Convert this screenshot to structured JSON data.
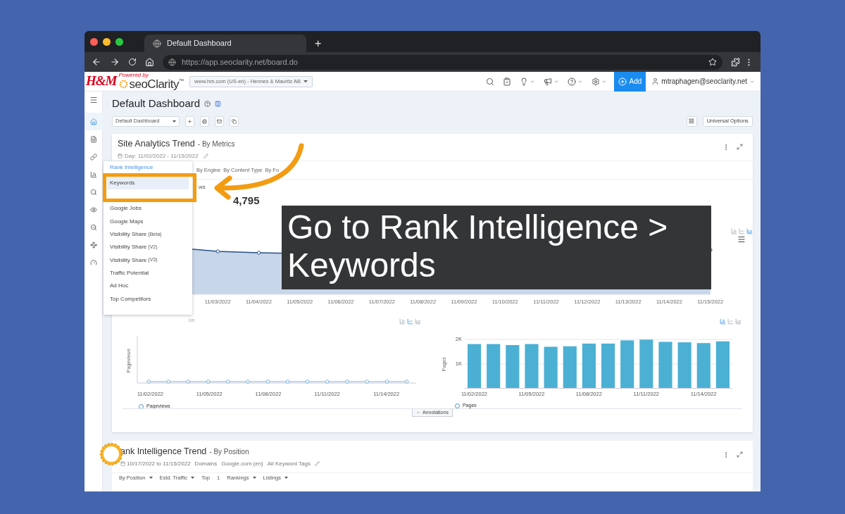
{
  "browser": {
    "tab_title": "Default Dashboard",
    "new_tab": "+",
    "url": "https://app.seoclarity.net/board.do"
  },
  "header": {
    "client_logo": "H&M",
    "powered_by": "Powered by",
    "brand": "seoClarity",
    "trademark": "™",
    "domain_select": "www.hm.com (US-en) - Hennes & Mauritz AB",
    "add_button": "Add",
    "user": "mtraphagen@seoclarity.net",
    "tools": [
      {
        "kind": "search",
        "caret": false
      },
      {
        "kind": "clipboard",
        "caret": false
      },
      {
        "kind": "bulb",
        "caret": true
      },
      {
        "kind": "megaphone",
        "caret": true
      },
      {
        "kind": "help",
        "caret": true
      },
      {
        "kind": "settings",
        "caret": true
      }
    ]
  },
  "sidebar": {
    "items": [
      {
        "kind": "home",
        "selected": true
      },
      {
        "kind": "document",
        "selected": false
      },
      {
        "kind": "link",
        "selected": false
      },
      {
        "kind": "chart",
        "selected": false
      },
      {
        "kind": "search",
        "selected": false
      },
      {
        "kind": "eye",
        "selected": false
      },
      {
        "kind": "search-check",
        "selected": false
      },
      {
        "kind": "nodes",
        "selected": false
      },
      {
        "kind": "gauge",
        "selected": false
      }
    ]
  },
  "dashboard": {
    "title": "Default Dashboard",
    "select": "Default Dashboard",
    "universal_options": "Universal Options"
  },
  "site_analytics": {
    "title": "Site Analytics Trend",
    "subtitle": "- By Metrics",
    "date": "Day: 11/02/2022 - 11/15/2022",
    "tabs": [
      "By Engine",
      "By Content Type",
      "By Fo"
    ],
    "metric_label": "ws",
    "metric_value": "4,795",
    "main_chart_x": [
      "11/03/2022",
      "11/04/2022",
      "11/05/2022",
      "11/06/2022",
      "11/07/2022",
      "11/08/2022",
      "11/09/2022",
      "11/10/2022",
      "11/11/2022",
      "11/12/2022",
      "11/13/2022",
      "11/14/2022",
      "11/15/2022"
    ],
    "fragment": "ion",
    "pageviews_chart": {
      "ylabel": "Pageviews",
      "xlabels": [
        "11/02/2022",
        "11/05/2022",
        "11/08/2022",
        "11/11/2022",
        "11/14/2022"
      ],
      "legend": "Pageviews"
    },
    "pages_chart": {
      "legend": "Pages",
      "chart_data": {
        "type": "bar",
        "ylabel": "Pages",
        "categories": [
          "11/02/2022",
          null,
          null,
          "11/05/2022",
          null,
          null,
          "11/08/2022",
          null,
          null,
          "11/11/2022",
          null,
          null,
          "11/14/2022",
          null
        ],
        "values": [
          1810,
          1810,
          1770,
          1810,
          1700,
          1720,
          1830,
          1830,
          1960,
          1990,
          1900,
          1880,
          1850,
          1920
        ],
        "ylim": [
          0,
          2000
        ],
        "yticks": [
          {
            "value": 1000,
            "label": "1K"
          },
          {
            "value": 2000,
            "label": "2K"
          }
        ]
      }
    },
    "annotations": "Annotations"
  },
  "rank_trend": {
    "title": "ank Intelligence Trend",
    "subtitle": "- By Position",
    "filters": [
      "10/17/2022 to 11/15/2022",
      "Domains",
      "Google.com (en)",
      "All Keyword Tags"
    ],
    "controls": [
      {
        "label": "By Position",
        "caret": true
      },
      {
        "label": "Estd. Traffic",
        "caret": true
      },
      {
        "label": "Top",
        "caret": false
      },
      {
        "label": "1",
        "caret": false
      },
      {
        "label": "Rankings",
        "caret": true
      },
      {
        "label": "Listings",
        "caret": true
      }
    ]
  },
  "menu": {
    "header": "Rank Intelligence",
    "items": [
      {
        "label": "Keywords",
        "selected": true
      },
      {
        "label": "Google Jobs",
        "selected": false
      },
      {
        "label": "Google Maps",
        "selected": false
      },
      {
        "label": "Visibility Share",
        "tag": "(Beta)",
        "selected": false
      },
      {
        "label": "Visibility Share",
        "tag": "(V2)",
        "selected": false
      },
      {
        "label": "Visibility Share",
        "tag": "(V3)",
        "selected": false
      },
      {
        "label": "Traffic Potential",
        "selected": false
      },
      {
        "label": "Ad Hoc",
        "selected": false
      },
      {
        "label": "Top Competitors",
        "selected": false
      }
    ]
  },
  "overlay": {
    "caption": "Go to Rank Intelligence > Keywords"
  }
}
